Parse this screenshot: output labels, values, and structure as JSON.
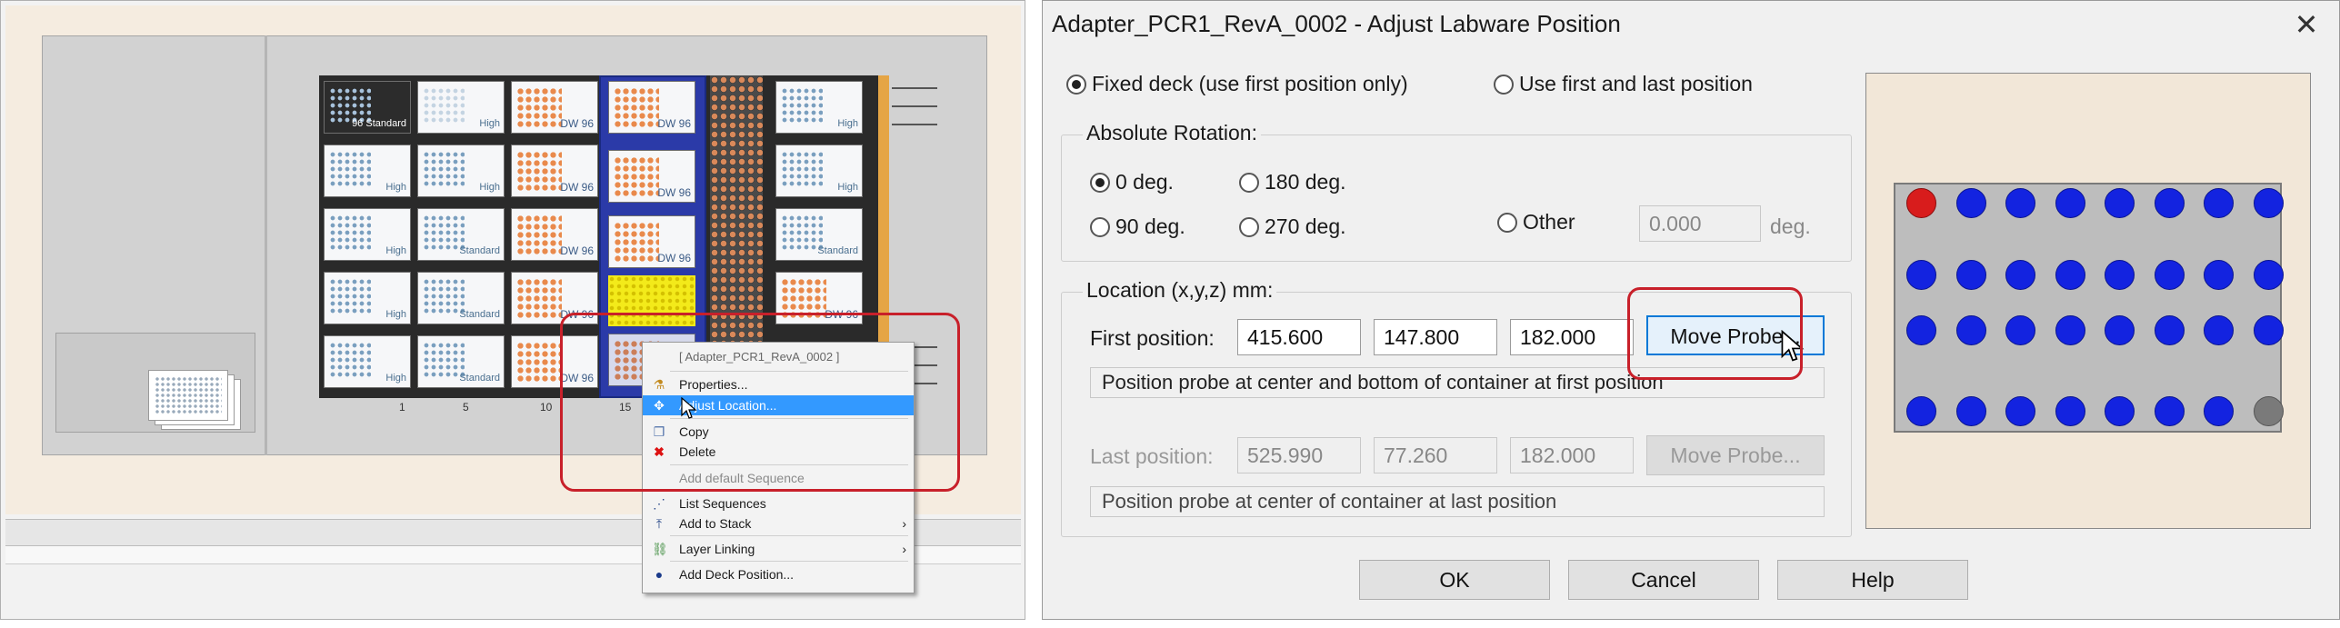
{
  "left_panel": {
    "context_menu": {
      "header": "[ Adapter_PCR1_RevA_0002 ]",
      "items": [
        {
          "label": "Properties...",
          "icon": "properties-icon"
        },
        {
          "label": "Adjust Location...",
          "icon": "move-icon",
          "selected": true
        },
        {
          "label": "Copy",
          "icon": "copy-icon"
        },
        {
          "label": "Delete",
          "icon": "delete-icon"
        },
        {
          "label": "Add default Sequence",
          "disabled": true
        },
        {
          "label": "List Sequences",
          "icon": "list-sequences-icon"
        },
        {
          "label": "Add to Stack",
          "icon": "add-to-stack-icon",
          "submenu": true
        },
        {
          "label": "Layer Linking",
          "icon": "layer-linking-icon",
          "submenu": true
        },
        {
          "label": "Add Deck Position...",
          "icon": "deck-position-icon"
        }
      ],
      "submenu_arrow": "›"
    },
    "track_numbers": [
      "1",
      "5",
      "10",
      "15"
    ],
    "tiles": {
      "col1": [
        "96 Standard",
        "High",
        "High",
        "High",
        "High"
      ],
      "col2": [
        "High",
        "High",
        "Standard",
        "Standard",
        "Standard"
      ],
      "col3": [
        "DW 96",
        "DW 96",
        "DW 96",
        "DW 96",
        "DW 96"
      ],
      "col4": [
        "DW 96",
        "DW 96",
        "DW 96"
      ],
      "col6": [
        "High",
        "High",
        "Standard",
        "DW 96"
      ]
    }
  },
  "dialog": {
    "title": "Adapter_PCR1_RevA_0002 - Adjust Labware Position",
    "close": "✕",
    "mode_options": [
      {
        "label": "Fixed deck (use first position only)",
        "selected": true
      },
      {
        "label": "Use first and last position",
        "selected": false
      }
    ],
    "rotation": {
      "group_label": "Absolute Rotation:",
      "options": [
        {
          "label": "0 deg.",
          "selected": true
        },
        {
          "label": "180 deg.",
          "selected": false
        },
        {
          "label": "90 deg.",
          "selected": false
        },
        {
          "label": "270 deg.",
          "selected": false
        },
        {
          "label": "Other",
          "selected": false
        }
      ],
      "other_value": "0.000",
      "other_unit": "deg."
    },
    "location": {
      "group_label": "Location (x,y,z) mm:",
      "first_label": "First position:",
      "first_values": [
        "415.600",
        "147.800",
        "182.000"
      ],
      "first_button": "Move Probe...",
      "first_message": "Position probe at center and bottom of container at first position",
      "last_label": "Last position:",
      "last_values": [
        "525.990",
        "77.260",
        "182.000"
      ],
      "last_button": "Move Probe...",
      "last_message": "Position probe at center of container at last position"
    },
    "buttons": {
      "ok": "OK",
      "cancel": "Cancel",
      "help": "Help"
    },
    "preview": {
      "rows": 4,
      "cols": 8,
      "colors": {
        "well": "#1323e0",
        "first_well": "#d81c1c",
        "last_well": "#7a7a7a",
        "plate": "#bdbdbd",
        "background": "#f2e7d8"
      }
    }
  },
  "colors": {
    "highlight": "#c8202a",
    "selection": "#3399ff"
  }
}
